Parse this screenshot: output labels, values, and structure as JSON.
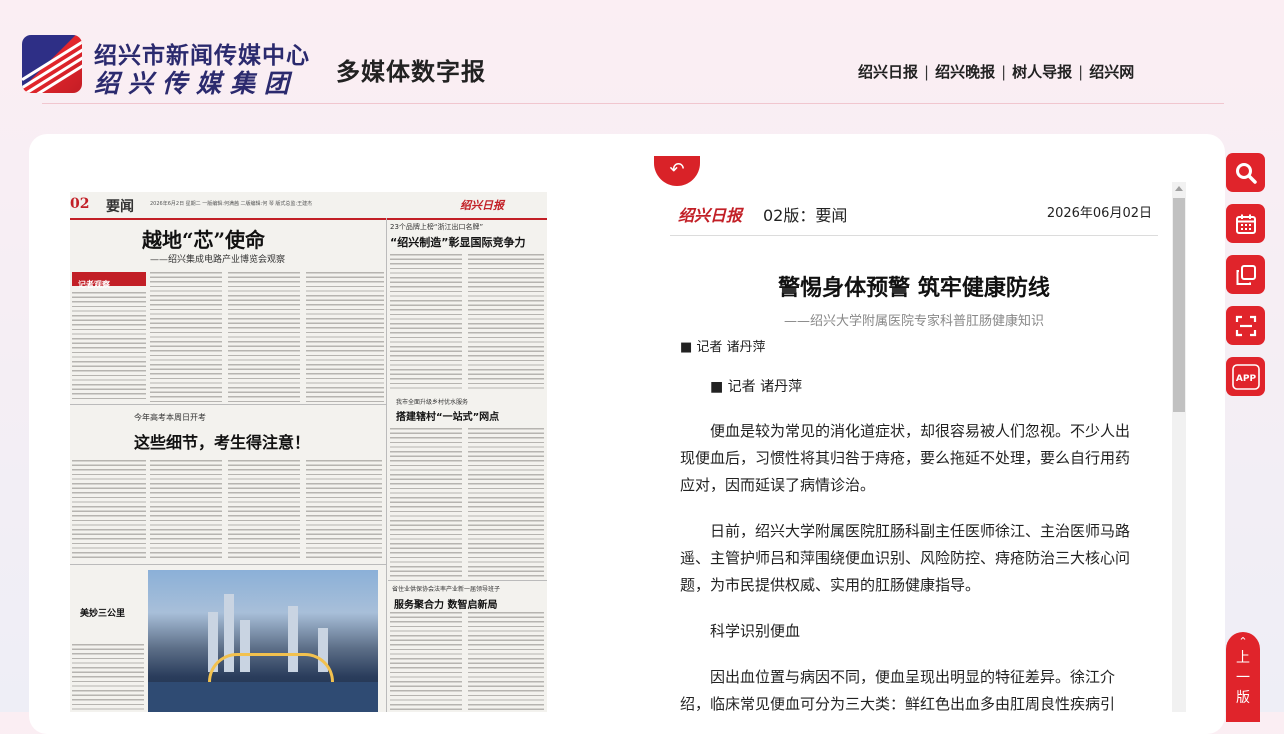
{
  "header": {
    "org_line1": "绍兴市新闻传媒中心",
    "org_line2": "绍兴传媒集团",
    "subtitle": "多媒体数字报",
    "nav": [
      "绍兴日报",
      "绍兴晚报",
      "树人导报",
      "绍兴网"
    ]
  },
  "newspaper_page": {
    "page_num": "02",
    "section": "要闻",
    "meta": "2026年6月2日  星期二  一版编辑:何满茜  二版编辑:何  琴  版式总监:王建杰",
    "brand": "绍兴日报",
    "headline": "越地“芯”使命",
    "headline_sub": "——绍兴集成电路产业博览会观察",
    "box_label": "记者观察",
    "side_kicker": "23个品牌上榜“浙江出口名牌”",
    "side_headline": "“绍兴制造”彰显国际竞争力",
    "mid_kicker": "今年高考本周日开考",
    "mid_headline": "这些细节，考生得注意！",
    "right_kicker": "我市全面升级乡村优水服务",
    "right_headline": "搭建辖村“一站式”网点",
    "bottom_kicker": "省住业供保协会法率产业新一届领导班子",
    "bottom_headline": "服务聚合力  数智启新局",
    "photo_caption": "美妙三公里"
  },
  "article": {
    "paper_logo": "绍兴日报",
    "edition": "02版：要闻",
    "date": "2026年06月02日",
    "title": "警惕身体预警 筑牢健康防线",
    "subtitle": "——绍兴大学附属医院专家科普肛肠健康知识",
    "byline": "■ 记者 诸丹萍",
    "byline2": "■ 记者 诸丹萍",
    "paragraphs": [
      "便血是较为常见的消化道症状，却很容易被人们忽视。不少人出现便血后，习惯性将其归咎于痔疮，要么拖延不处理，要么自行用药应对，因而延误了病情诊治。",
      "日前，绍兴大学附属医院肛肠科副主任医师徐江、主治医师马路遥、主管护师吕和萍围绕便血识别、风险防控、痔疮防治三大核心问题，为市民提供权威、实用的肛肠健康指导。",
      "科学识别便血",
      "因出血位置与病因不同，便血呈现出明显的特征差异。徐江介绍，临床常见便血可分为三大类：鲜红色出血多由肛周良性疾病引"
    ]
  },
  "toolbar": {
    "tools": [
      "search-icon",
      "calendar-icon",
      "copy-icon",
      "scan-icon",
      "app-icon"
    ],
    "app_label": "APP",
    "back_top_chars": [
      "上",
      "一",
      "版"
    ]
  },
  "colors": {
    "accent": "#e0242b",
    "navy": "#2b2a6e"
  }
}
